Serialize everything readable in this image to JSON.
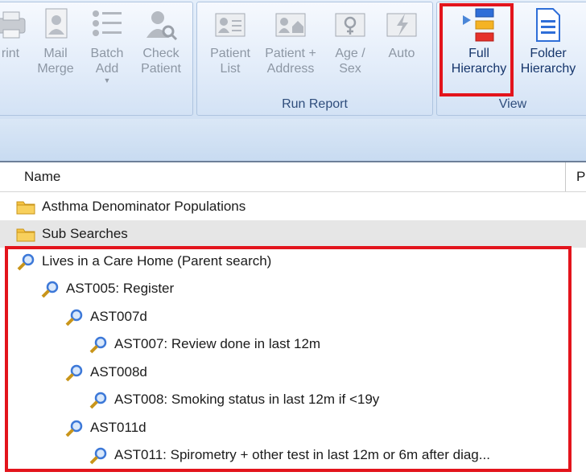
{
  "ribbon": {
    "actions_group": {
      "buttons": [
        {
          "label_l1": "rint",
          "label_l2": ""
        },
        {
          "label_l1": "Mail",
          "label_l2": "Merge"
        },
        {
          "label_l1": "Batch",
          "label_l2": "Add"
        },
        {
          "label_l1": "Check",
          "label_l2": "Patient"
        }
      ]
    },
    "run_report": {
      "label": "Run Report",
      "buttons": [
        {
          "label_l1": "Patient",
          "label_l2": "List"
        },
        {
          "label_l1": "Patient +",
          "label_l2": "Address"
        },
        {
          "label_l1": "Age /",
          "label_l2": "Sex"
        },
        {
          "label_l1": "Auto",
          "label_l2": ""
        }
      ]
    },
    "view": {
      "label": "View",
      "buttons": [
        {
          "label_l1": "Full",
          "label_l2": "Hierarchy"
        },
        {
          "label_l1": "Folder",
          "label_l2": "Hierarchy"
        }
      ]
    }
  },
  "tree": {
    "columns": {
      "name": "Name",
      "partial": "P"
    },
    "items": [
      {
        "label": "Asthma Denominator Populations",
        "type": "folder"
      },
      {
        "label": "Sub Searches",
        "type": "folder",
        "selected": true
      },
      {
        "label": "Lives in a Care Home (Parent search)",
        "type": "search"
      },
      {
        "label": "AST005: Register",
        "type": "search"
      },
      {
        "label": "AST007d",
        "type": "search"
      },
      {
        "label": "AST007: Review done in last 12m",
        "type": "search"
      },
      {
        "label": "AST008d",
        "type": "search"
      },
      {
        "label": "AST008: Smoking status in last 12m if <19y",
        "type": "search"
      },
      {
        "label": "AST011d",
        "type": "search"
      },
      {
        "label": "AST011: Spirometry + other test in last 12m or 6m after diag...",
        "type": "search"
      }
    ]
  },
  "colors": {
    "highlight": "#e3141c",
    "folder": "#f5c342",
    "search": "#3c78d8"
  }
}
